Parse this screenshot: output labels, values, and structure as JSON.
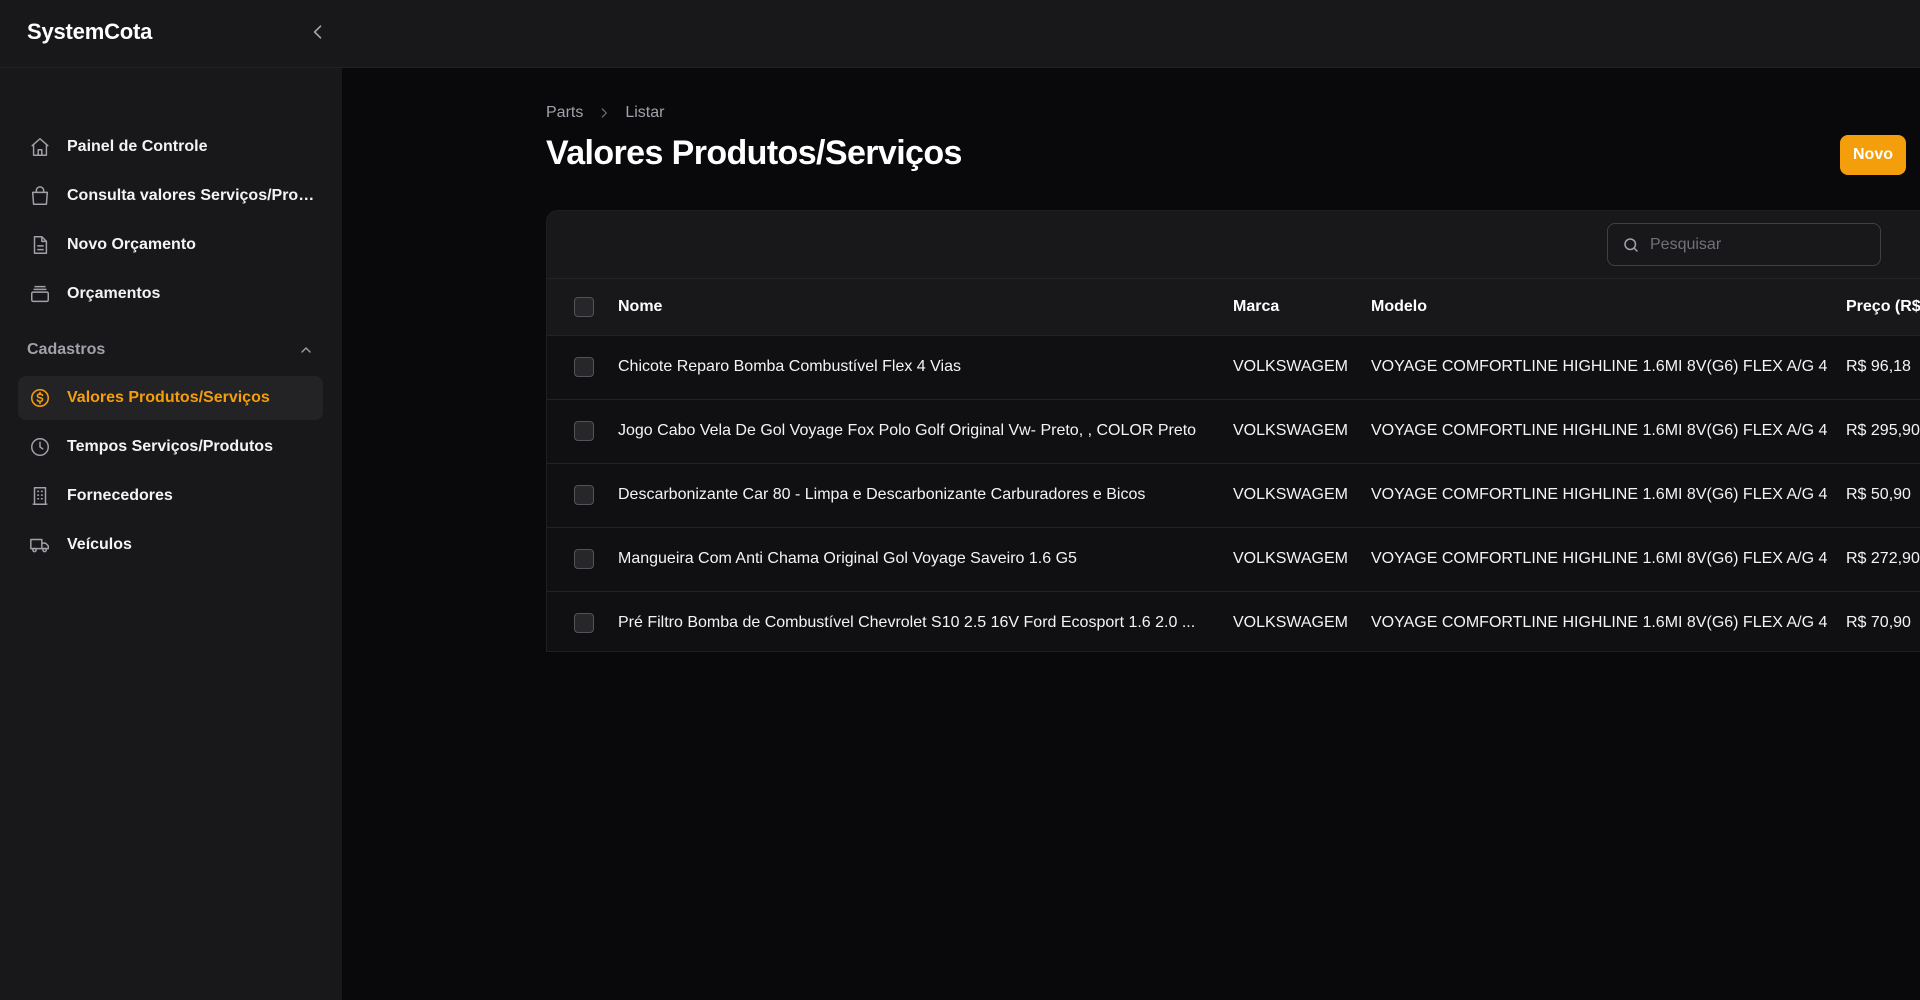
{
  "app": {
    "title": "SystemCota"
  },
  "sidebar": {
    "items": [
      {
        "label": "Painel de Controle",
        "icon": "home-icon"
      },
      {
        "label": "Consulta valores Serviços/Produtos",
        "icon": "shopping-bag-icon"
      },
      {
        "label": "Novo Orçamento",
        "icon": "document-icon"
      },
      {
        "label": "Orçamentos",
        "icon": "archive-icon"
      }
    ],
    "groups": [
      {
        "label": "Cadastros",
        "items": [
          {
            "label": "Valores Produtos/Serviços",
            "icon": "currency-dollar-icon",
            "active": true
          },
          {
            "label": "Tempos Serviços/Produtos",
            "icon": "clock-icon"
          },
          {
            "label": "Fornecedores",
            "icon": "building-icon"
          },
          {
            "label": "Veículos",
            "icon": "truck-icon"
          }
        ]
      }
    ]
  },
  "breadcrumb": [
    "Parts",
    "Listar"
  ],
  "page": {
    "title": "Valores Produtos/Serviços",
    "new_button": "Novo"
  },
  "search": {
    "placeholder": "Pesquisar",
    "value": ""
  },
  "table": {
    "columns": [
      "Nome",
      "Marca",
      "Modelo",
      "Preço (R$)"
    ],
    "rows": [
      {
        "nome": "Chicote Reparo Bomba Combustível Flex 4 Vias",
        "marca": "VOLKSWAGEM",
        "modelo": "VOYAGE COMFORTLINE HIGHLINE 1.6MI 8V(G6) FLEX A/G 4",
        "preco": "R$ 96,18"
      },
      {
        "nome": "Jogo Cabo Vela De Gol Voyage Fox Polo Golf Original Vw- Preto, , COLOR Preto",
        "marca": "VOLKSWAGEM",
        "modelo": "VOYAGE COMFORTLINE HIGHLINE 1.6MI 8V(G6) FLEX A/G 4",
        "preco": "R$ 295,90"
      },
      {
        "nome": "Descarbonizante Car 80 - Limpa e Descarbonizante Carburadores e Bicos",
        "marca": "VOLKSWAGEM",
        "modelo": "VOYAGE COMFORTLINE HIGHLINE 1.6MI 8V(G6) FLEX A/G 4",
        "preco": "R$ 50,90"
      },
      {
        "nome": "Mangueira Com Anti Chama Original Gol Voyage Saveiro 1.6 G5",
        "marca": "VOLKSWAGEM",
        "modelo": "VOYAGE COMFORTLINE HIGHLINE 1.6MI 8V(G6) FLEX A/G 4",
        "preco": "R$ 272,90"
      },
      {
        "nome": "Pré Filtro Bomba de Combustível Chevrolet S10 2.5 16V Ford Ecosport 1.6 2.0 ...",
        "marca": "VOLKSWAGEM",
        "modelo": "VOYAGE COMFORTLINE HIGHLINE 1.6MI 8V(G6) FLEX A/G 4",
        "preco": "R$ 70,90"
      }
    ]
  },
  "colors": {
    "accent": "#f59e0b",
    "background": "#09090b",
    "surface": "#18181b",
    "muted_text": "#a1a1aa"
  }
}
